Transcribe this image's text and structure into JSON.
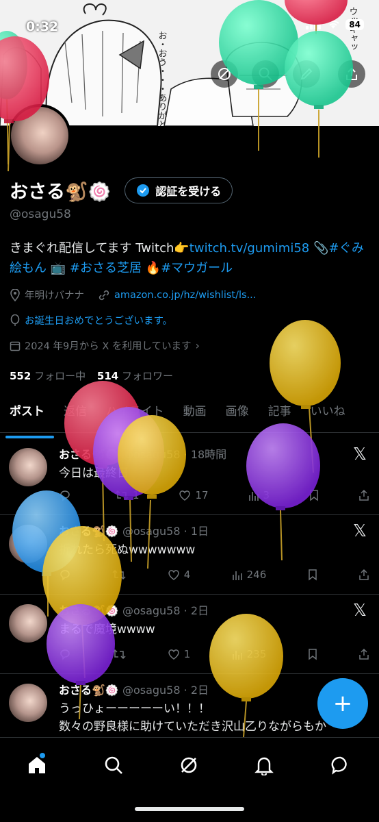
{
  "status": {
    "time": "0:32",
    "battery": "84"
  },
  "banner": {
    "speech1": "お・おう・・・ありがとう・・・"
  },
  "profile": {
    "display_name": "おさる🐒🍥",
    "verify_label": "認証を受ける",
    "handle": "@osagu58",
    "bio_prefix": "きまぐれ配信してます Twitch👉",
    "bio_link": "twitch.tv/gumimi58",
    "bio_clip": " 📎",
    "bio_tag1": "#ぐみ絵もん",
    "bio_tv": " 📺 ",
    "bio_tag2": "#おさる芝居",
    "bio_fire": " 🔥",
    "bio_tag3": "#マウガール",
    "location": "年明けバナナ",
    "website": "amazon.co.jp/hz/wishlist/ls...",
    "birthday": "お誕生日おめでとうございます。",
    "joined": "2024 年9月から X を利用しています",
    "following_count": "552",
    "following_label": "フォロー中",
    "followers_count": "514",
    "followers_label": "フォロワー"
  },
  "tabs": [
    "ポスト",
    "返信",
    "ハイライト",
    "動画",
    "画像",
    "記事",
    "いいね"
  ],
  "posts": [
    {
      "name": "おさる🐒🍥",
      "handle": "@osagu58",
      "time": "18時間",
      "text": "今日は最終日",
      "replies": "",
      "reposts": "1",
      "likes": "17",
      "views": "3"
    },
    {
      "name": "おさる🐒🍥",
      "handle": "@osagu58",
      "time": "1日",
      "text": "折れたら死ぬwwwwwww",
      "replies": "",
      "reposts": "",
      "likes": "4",
      "views": "246"
    },
    {
      "name": "おさる🐒🍥",
      "handle": "@osagu58",
      "time": "2日",
      "text": "まるで魔境wwww",
      "replies": "",
      "reposts": "",
      "likes": "1",
      "views": "235"
    },
    {
      "name": "おさる🐒🍥",
      "handle": "@osagu58",
      "time": "2日",
      "text": "うっひょーーーーーい！！！",
      "text2": "数々の野良様に助けていただき沢山乙りながらもか"
    }
  ],
  "colors": {
    "accent": "#1d9bf0",
    "background": "#000000",
    "muted": "#71767b"
  },
  "icons": [
    "home-icon",
    "search-icon",
    "grok-icon",
    "bell-icon",
    "messages-icon",
    "plus-icon",
    "x-logo-icon"
  ]
}
